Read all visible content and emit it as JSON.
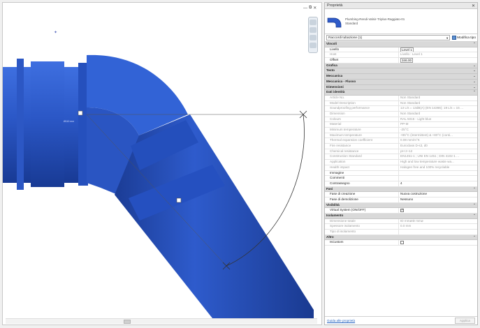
{
  "viewport": {
    "dimension_label": "Ø110 mm",
    "view_controls": [
      "—",
      "⧉",
      "✕"
    ]
  },
  "props": {
    "title": "Proprietà",
    "type_name": "Plumbing-Rendi-Valsir-Triplus-Raggiato-01",
    "type_sub": "Standard",
    "selector": "Raccordi tubazione (1)",
    "edit_type": "Modifica tipo",
    "sections": [
      {
        "name": "Vincoli",
        "rows": [
          {
            "k": "Livello",
            "v": "Level 1",
            "style": "box"
          },
          {
            "k": "Host",
            "v": "Livello : Level 1",
            "style": "dim"
          },
          {
            "k": "Offset",
            "v": "346.00",
            "style": "box"
          }
        ]
      },
      {
        "name": "Grafica",
        "rows": []
      },
      {
        "name": "Testo",
        "rows": []
      },
      {
        "name": "Meccanica",
        "rows": []
      },
      {
        "name": "Meccanica - Flusso",
        "rows": []
      },
      {
        "name": "Dimensioni",
        "rows": []
      },
      {
        "name": "Dati identità",
        "rows": [
          {
            "k": "Article No.",
            "v": "Non Standard",
            "style": "dim"
          },
          {
            "k": "Model Description",
            "v": "Non Standard",
            "style": "dim"
          },
          {
            "k": "Soundproofing performance",
            "v": "13 L/s = 13dB(A) (EN 14366); 19 L/s = 15 ...",
            "style": "dim"
          },
          {
            "k": "Dimension",
            "v": "Non Standard",
            "style": "dim"
          },
          {
            "k": "Colours",
            "v": "RAL 5015 - Light blue",
            "style": "dim"
          },
          {
            "k": "Material",
            "v": "PP-M",
            "style": "dim"
          },
          {
            "k": "Minimum temperature",
            "v": "-25°C",
            "style": "dim"
          },
          {
            "k": "Maximum temperature",
            "v": "+95°C (intermittent) & +80°C (conti...",
            "style": "dim"
          },
          {
            "k": "Thermal expansion coefficient",
            "v": "0.08 mm/m°K",
            "style": "dim"
          },
          {
            "k": "Fire resistance",
            "v": "Euroclass D-s3, d0",
            "style": "dim"
          },
          {
            "k": "Chemical resistance",
            "v": "pH 2÷12",
            "style": "dim"
          },
          {
            "k": "Construction Standard",
            "v": "EN1451-1 ; UNI EN 1451 ; DIN 4102-1 ...",
            "style": "dim"
          },
          {
            "k": "Application",
            "v": "High and low temperature waste wa...",
            "style": "dim"
          },
          {
            "k": "Health impact",
            "v": "Halogen free and 100% recyclable",
            "style": "dim"
          },
          {
            "k": "Immagine",
            "v": "",
            "style": ""
          },
          {
            "k": "Commenti",
            "v": "",
            "style": ""
          },
          {
            "k": "Contrassegno",
            "v": "4",
            "style": ""
          }
        ]
      },
      {
        "name": "Fasi",
        "rows": [
          {
            "k": "Fase di creazione",
            "v": "Nuova costruzione",
            "style": ""
          },
          {
            "k": "Fase di demolizione",
            "v": "Nessuno",
            "style": ""
          }
        ]
      },
      {
        "name": "Visibilità",
        "rows": [
          {
            "k": "Virtual System (ON/OFF)",
            "v": "",
            "style": "check"
          }
        ]
      },
      {
        "name": "Isolamento",
        "rows": [
          {
            "k": "Dimensione totale",
            "v": "ID mmøID mmø",
            "style": "dim"
          },
          {
            "k": "Spessore isolamento",
            "v": "0.0 mm",
            "style": "dim"
          },
          {
            "k": "Tipo di isolamento",
            "v": "",
            "style": "dim"
          }
        ]
      },
      {
        "name": "Altro",
        "rows": [
          {
            "k": "IsCustom",
            "v": "",
            "style": "checkoff"
          }
        ]
      }
    ],
    "help_link": "Guida alle proprietà",
    "apply": "Applica"
  },
  "colors": {
    "pipe": "#2f5bc9",
    "pipe_dark": "#1c3c8f",
    "section_bg": "#d9d9d9"
  }
}
